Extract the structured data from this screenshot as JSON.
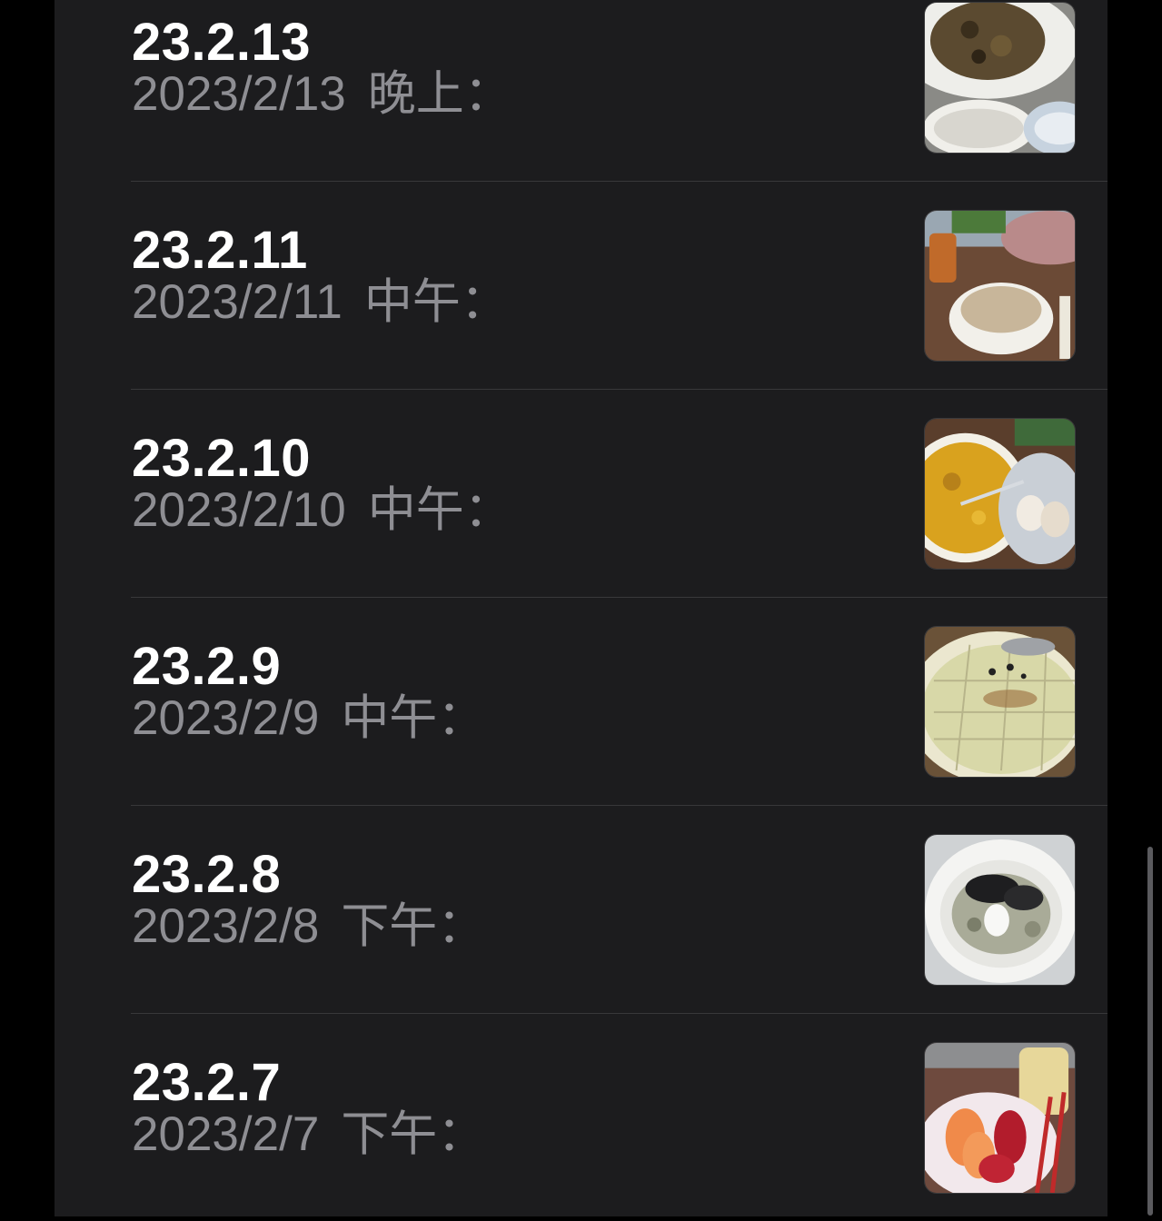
{
  "notes": [
    {
      "title": "23.2.13",
      "date": "2023/2/13",
      "time_label": "晚上：",
      "thumbnail": "food-photo-stir-fry-and-rice"
    },
    {
      "title": "23.2.11",
      "date": "2023/2/11",
      "time_label": "中午：",
      "thumbnail": "food-photo-bowl-of-mushrooms"
    },
    {
      "title": "23.2.10",
      "date": "2023/2/10",
      "time_label": "中午：",
      "thumbnail": "food-photo-soup-and-eggs"
    },
    {
      "title": "23.2.9",
      "date": "2023/2/9",
      "time_label": "中午：",
      "thumbnail": "food-photo-pancake"
    },
    {
      "title": "23.2.8",
      "date": "2023/2/8",
      "time_label": "下午：",
      "thumbnail": "food-photo-truffle-pasta"
    },
    {
      "title": "23.2.7",
      "date": "2023/2/7",
      "time_label": "下午：",
      "thumbnail": "food-photo-sashimi"
    }
  ],
  "colors": {
    "background": "#1c1c1e",
    "title": "#ffffff",
    "subtitle": "#8e8e93",
    "separator": "#38383a"
  }
}
